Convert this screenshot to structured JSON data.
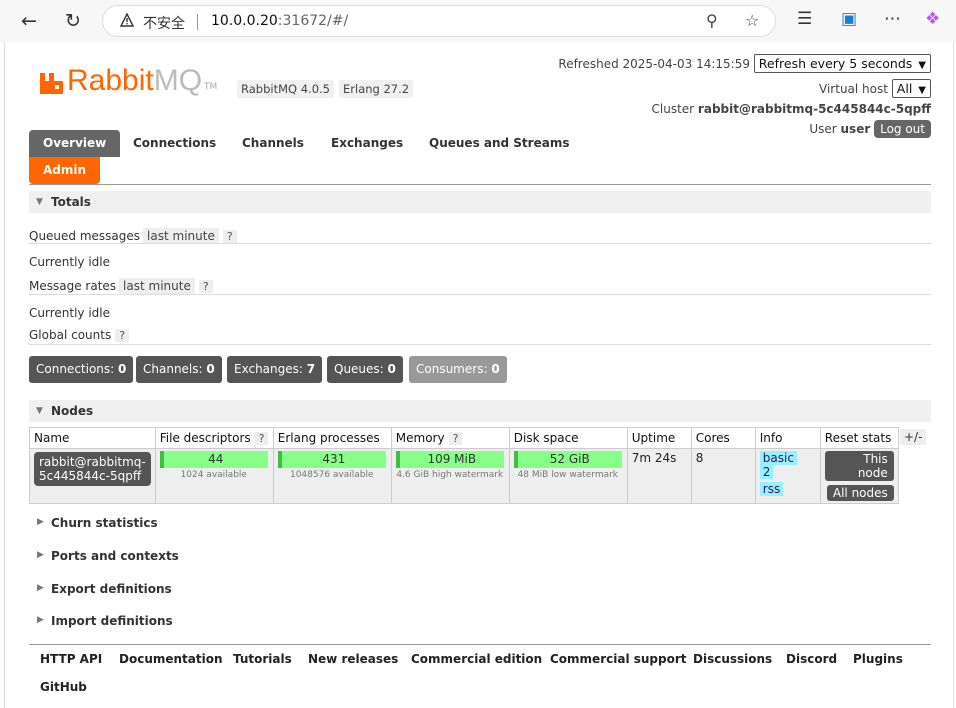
{
  "browser": {
    "insecure_label": "不安全",
    "url_host": "10.0.0.20",
    "url_rest": ":31672/#/"
  },
  "header": {
    "logo_rabbit": "Rabbit",
    "logo_mq": "MQ",
    "logo_tm": "TM",
    "rabbitmq_version": "RabbitMQ 4.0.5",
    "erlang_version": "Erlang 27.2",
    "refreshed": "Refreshed 2025-04-03 14:15:59",
    "refresh_select": "Refresh every 5 seconds",
    "vhost_label": "Virtual host",
    "vhost_value": "All",
    "cluster_label": "Cluster",
    "cluster_name": "rabbit@rabbitmq-5c445844c-5qpff",
    "user_label": "User",
    "user_name": "user",
    "logout": "Log out"
  },
  "tabs": [
    "Overview",
    "Connections",
    "Channels",
    "Exchanges",
    "Queues and Streams",
    "Admin"
  ],
  "totals": {
    "title": "Totals",
    "queued_label": "Queued messages",
    "queued_range": "last minute",
    "idle1": "Currently idle",
    "rates_label": "Message rates",
    "rates_range": "last minute",
    "idle2": "Currently idle",
    "global_label": "Global counts",
    "help": "?",
    "counts": [
      {
        "label": "Connections:",
        "value": "0"
      },
      {
        "label": "Channels:",
        "value": "0"
      },
      {
        "label": "Exchanges:",
        "value": "7"
      },
      {
        "label": "Queues:",
        "value": "0"
      },
      {
        "label": "Consumers:",
        "value": "0"
      }
    ]
  },
  "nodes": {
    "title": "Nodes",
    "columns": [
      "Name",
      "File descriptors",
      "Erlang processes",
      "Memory",
      "Disk space",
      "Uptime",
      "Cores",
      "Info",
      "Reset stats"
    ],
    "plusminus": "+/-",
    "row": {
      "name_line1": "rabbit@rabbitmq-",
      "name_line2": "5c445844c-5qpff",
      "fd_value": "44",
      "fd_sub": "1024 available",
      "proc_value": "431",
      "proc_sub": "1048576 available",
      "mem_value": "109 MiB",
      "mem_sub": "4.6 GiB high watermark",
      "disk_value": "52 GiB",
      "disk_sub": "48 MiB low watermark",
      "uptime": "7m 24s",
      "cores": "8",
      "info_basic": "basic",
      "info_count": "2",
      "info_rss": "rss",
      "reset_node": "This node",
      "reset_all": "All nodes"
    }
  },
  "collapsed_sections": [
    "Churn statistics",
    "Ports and contexts",
    "Export definitions",
    "Import definitions"
  ],
  "footer_links": [
    "HTTP API",
    "Documentation",
    "Tutorials",
    "New releases",
    "Commercial edition",
    "Commercial support",
    "Discussions",
    "Discord",
    "Plugins",
    "GitHub"
  ]
}
